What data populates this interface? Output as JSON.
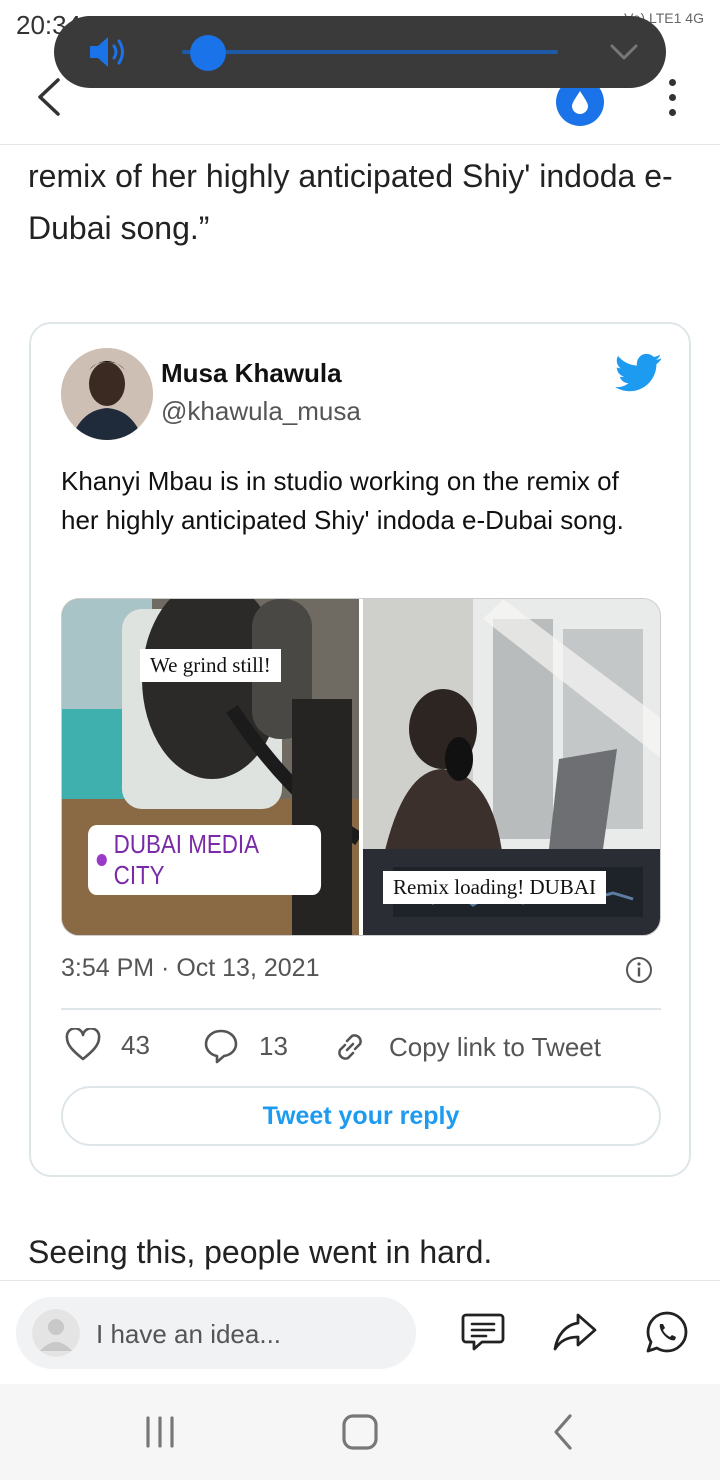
{
  "status_bar": {
    "time": "20:34",
    "right_indicators": "Vo) LTE1 4G"
  },
  "article": {
    "paragraph_top": "remix of her highly anticipated Shiy' indoda e-Dubai song.”",
    "paragraph_bottom": "Seeing this, people went in hard."
  },
  "tweet": {
    "author_name": "Musa Khawula",
    "author_handle": "@khawula_musa",
    "text": "Khanyi Mbau is in studio working on the remix of her highly anticipated Shiy' indoda e-Dubai song.",
    "media": {
      "left_caption": "We grind still!",
      "location_tag": "DUBAI MEDIA CITY",
      "right_caption": "Remix loading! DUBAI"
    },
    "timestamp": "3:54 PM · Oct 13, 2021",
    "likes": "43",
    "replies": "13",
    "copy_link_label": "Copy link to Tweet",
    "reply_button_label": "Tweet your reply"
  },
  "comment_bar": {
    "placeholder": "I have an idea..."
  },
  "volume": {
    "level": 0.07
  },
  "colors": {
    "twitter_blue": "#1d9bf0",
    "accent_blue": "#1a73e8",
    "overlay_bg": "#3a3a3a"
  }
}
